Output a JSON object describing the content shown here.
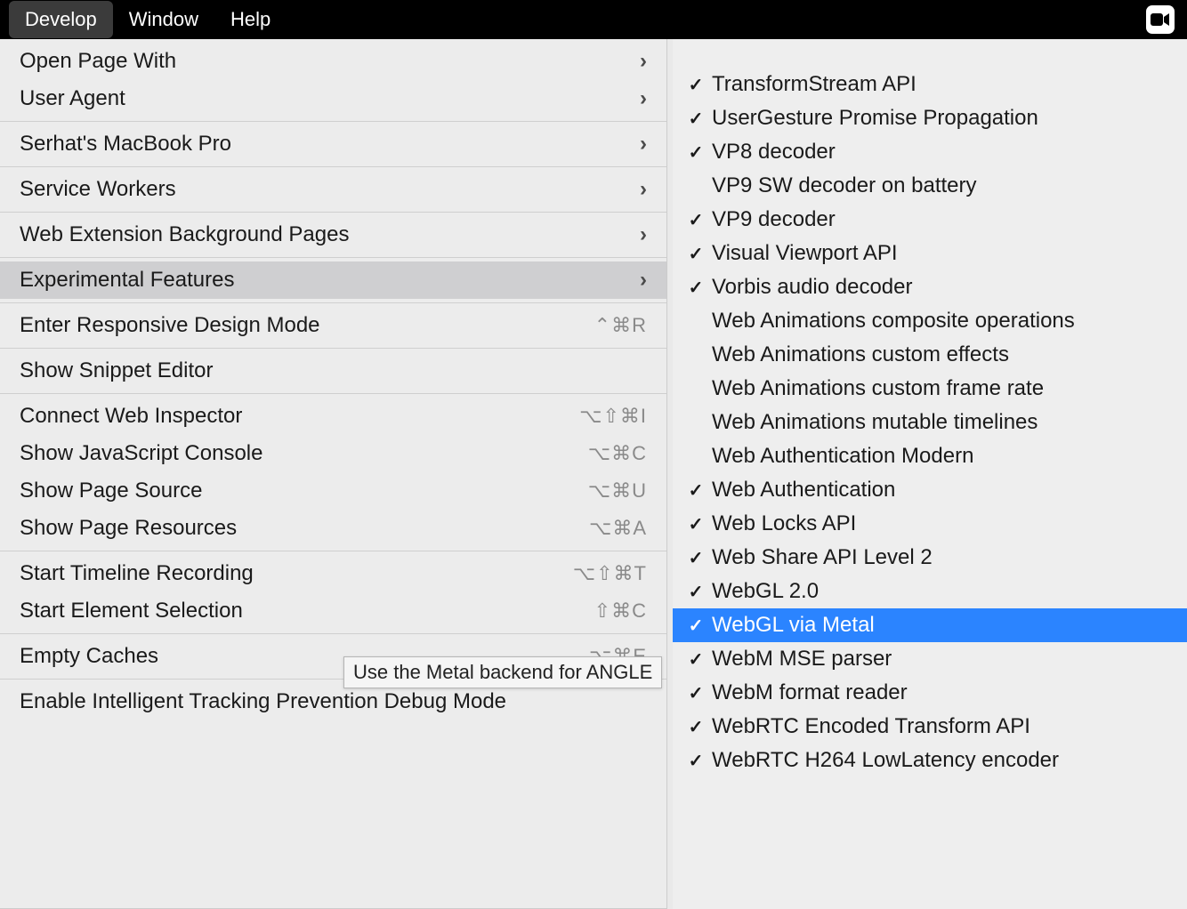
{
  "menubar": {
    "items": [
      {
        "label": "Develop",
        "active": true
      },
      {
        "label": "Window",
        "active": false
      },
      {
        "label": "Help",
        "active": false
      }
    ]
  },
  "develop_menu": {
    "sections": [
      [
        {
          "label": "Open Page With",
          "submenu": true
        },
        {
          "label": "User Agent",
          "submenu": true
        }
      ],
      [
        {
          "label": "Serhat's MacBook Pro",
          "submenu": true
        }
      ],
      [
        {
          "label": "Service Workers",
          "submenu": true
        }
      ],
      [
        {
          "label": "Web Extension Background Pages",
          "submenu": true
        }
      ],
      [
        {
          "label": "Experimental Features",
          "submenu": true,
          "highlighted": true
        }
      ],
      [
        {
          "label": "Enter Responsive Design Mode",
          "shortcut": "⌃⌘R"
        }
      ],
      [
        {
          "label": "Show Snippet Editor"
        }
      ],
      [
        {
          "label": "Connect Web Inspector",
          "shortcut": "⌥⇧⌘I"
        },
        {
          "label": "Show JavaScript Console",
          "shortcut": "⌥⌘C"
        },
        {
          "label": "Show Page Source",
          "shortcut": "⌥⌘U"
        },
        {
          "label": "Show Page Resources",
          "shortcut": "⌥⌘A"
        }
      ],
      [
        {
          "label": "Start Timeline Recording",
          "shortcut": "⌥⇧⌘T"
        },
        {
          "label": "Start Element Selection",
          "shortcut": "⇧⌘C"
        }
      ],
      [
        {
          "label": "Empty Caches",
          "shortcut": "⌥⌘E"
        }
      ],
      [
        {
          "label": "Enable Intelligent Tracking Prevention Debug Mode"
        }
      ]
    ]
  },
  "submenu": {
    "items": [
      {
        "label": "TransformStream API",
        "checked": true
      },
      {
        "label": "UserGesture Promise Propagation",
        "checked": true
      },
      {
        "label": "VP8 decoder",
        "checked": true
      },
      {
        "label": "VP9 SW decoder on battery",
        "checked": false
      },
      {
        "label": "VP9 decoder",
        "checked": true
      },
      {
        "label": "Visual Viewport API",
        "checked": true
      },
      {
        "label": "Vorbis audio decoder",
        "checked": true
      },
      {
        "label": "Web Animations composite operations",
        "checked": false
      },
      {
        "label": "Web Animations custom effects",
        "checked": false
      },
      {
        "label": "Web Animations custom frame rate",
        "checked": false
      },
      {
        "label": "Web Animations mutable timelines",
        "checked": false
      },
      {
        "label": "Web Authentication Modern",
        "checked": false
      },
      {
        "label": "Web Authentication",
        "checked": true
      },
      {
        "label": "Web Locks API",
        "checked": true
      },
      {
        "label": "Web Share API Level 2",
        "checked": true
      },
      {
        "label": "WebGL 2.0",
        "checked": true
      },
      {
        "label": "WebGL via Metal",
        "checked": true,
        "selected": true
      },
      {
        "label": "WebM MSE parser",
        "checked": true
      },
      {
        "label": "WebM format reader",
        "checked": true
      },
      {
        "label": "WebRTC Encoded Transform API",
        "checked": true
      },
      {
        "label": "WebRTC H264 LowLatency encoder",
        "checked": true
      }
    ]
  },
  "tooltip": {
    "text": "Use the Metal backend for ANGLE"
  }
}
